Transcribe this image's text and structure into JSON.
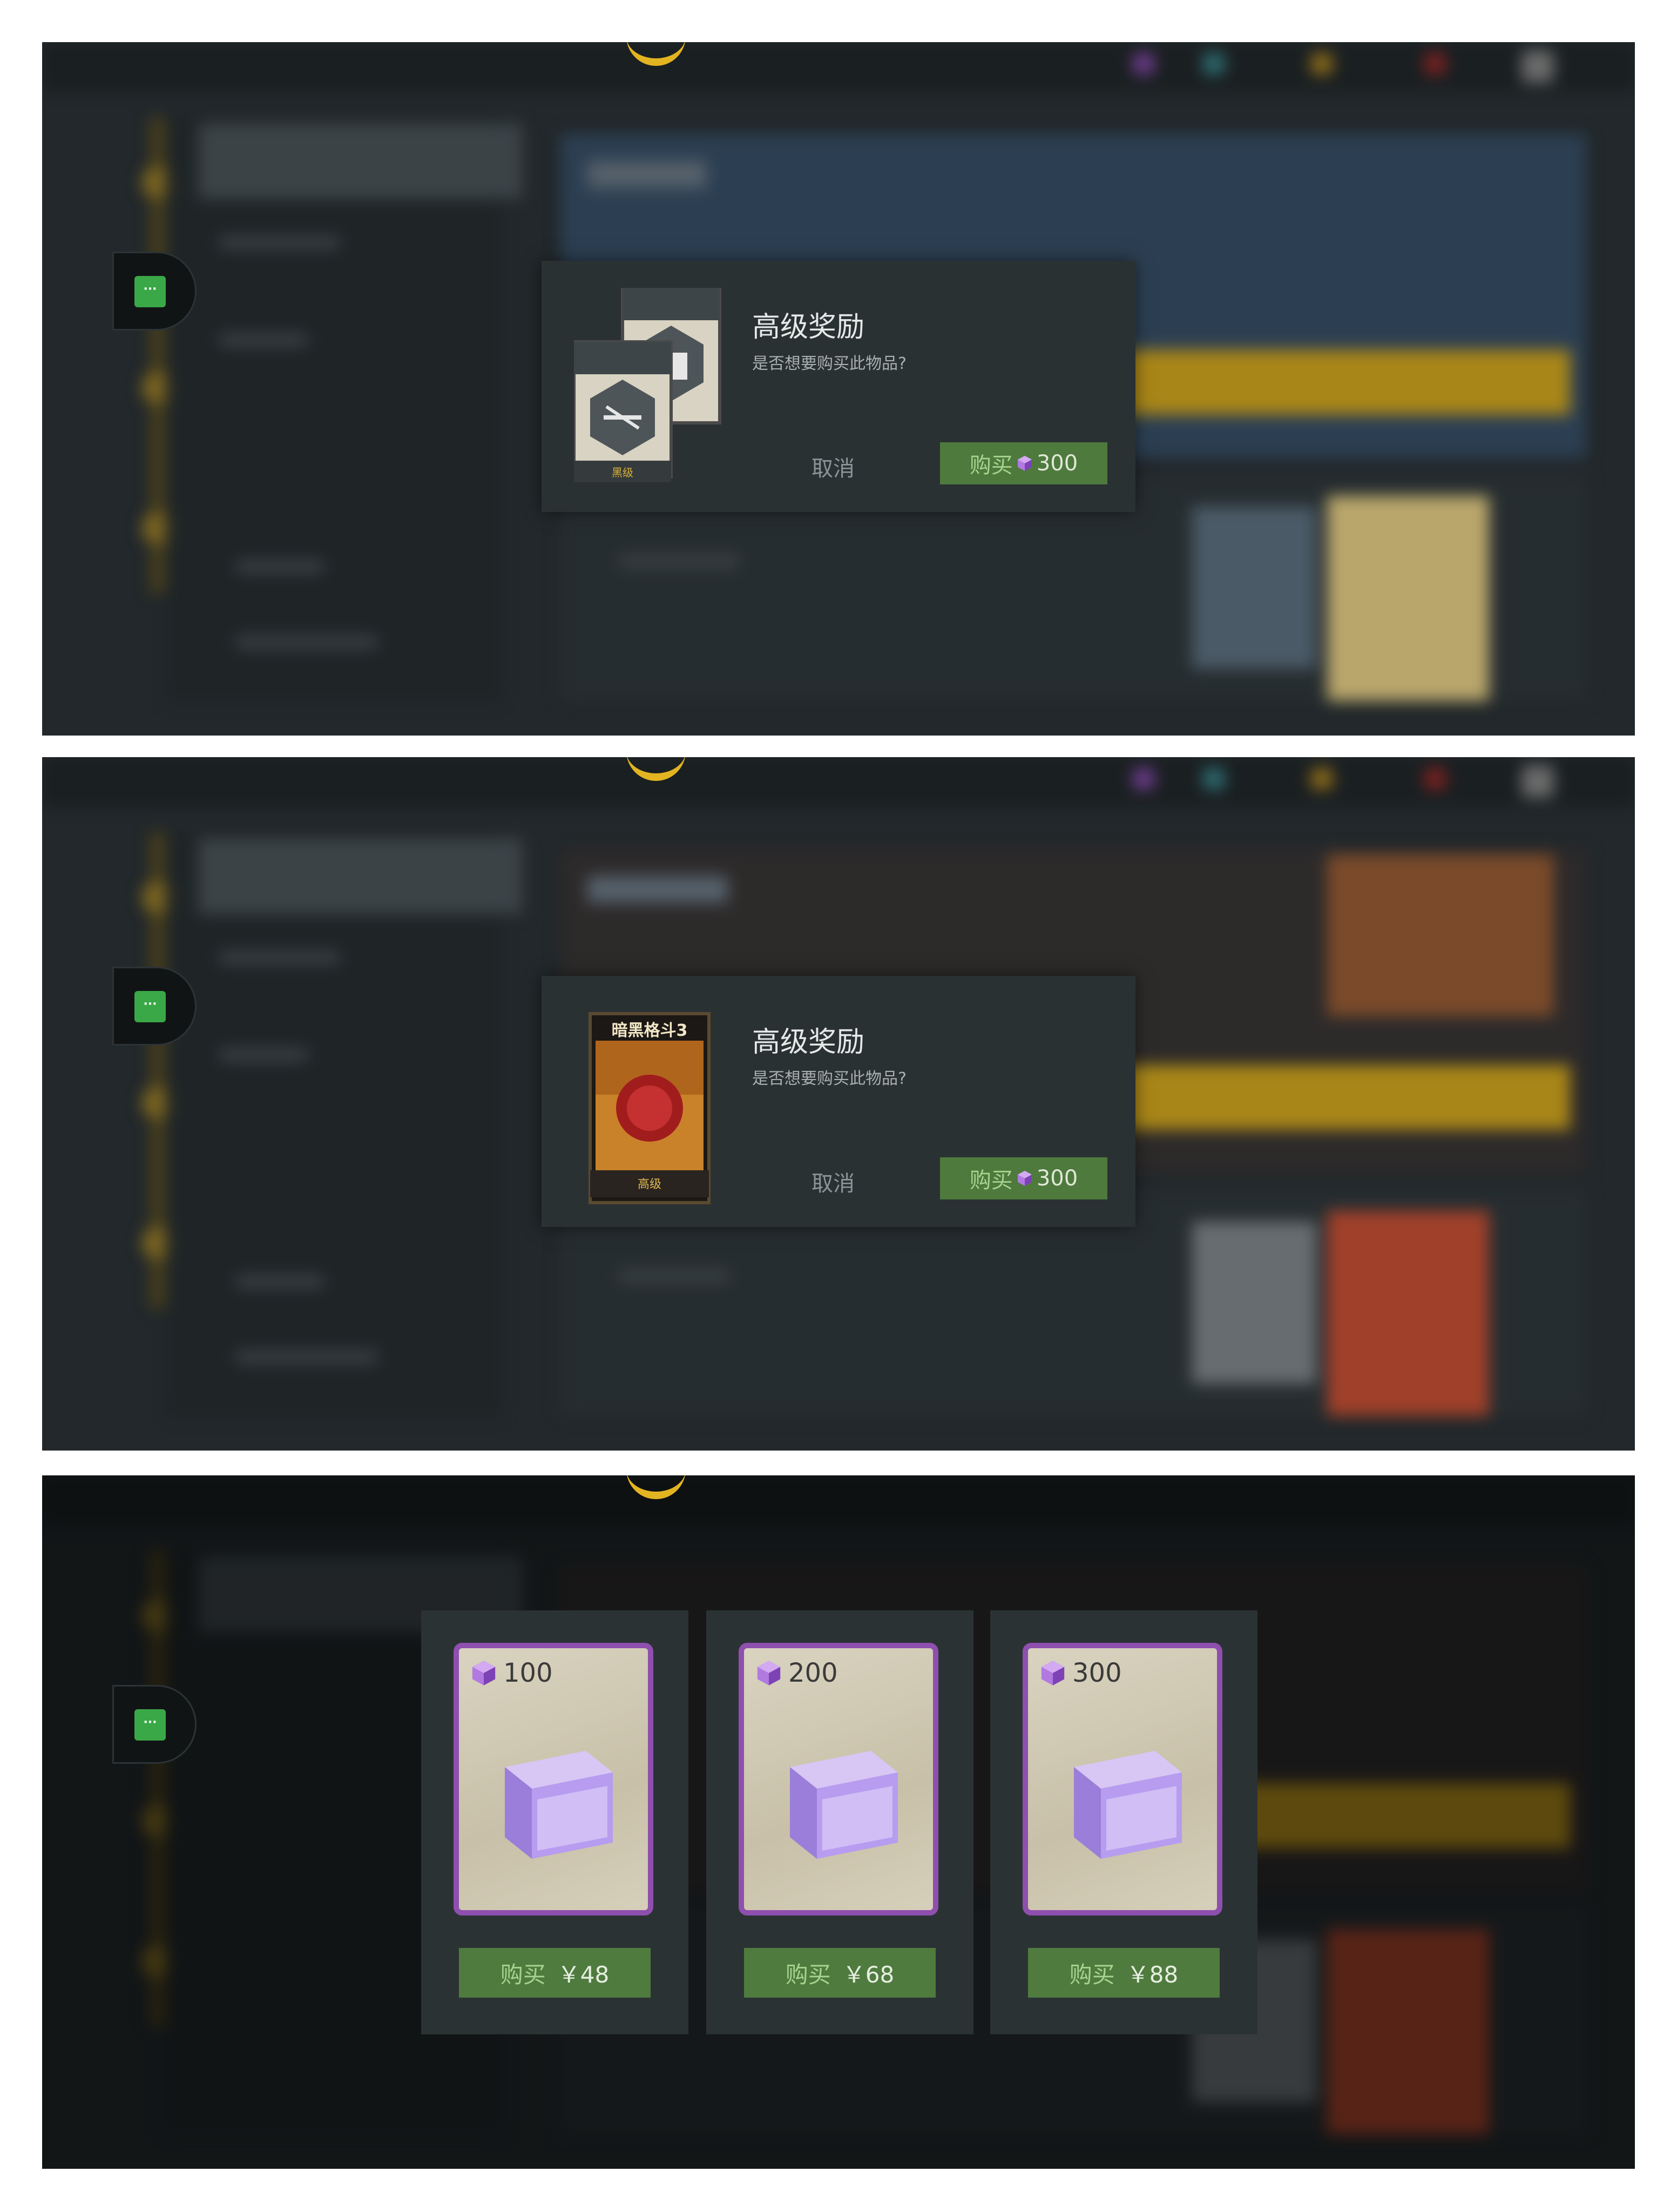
{
  "chat_button_label": "···",
  "dialogs": [
    {
      "title": "高级奖励",
      "question": "是否想要购买此物品?",
      "cancel": "取消",
      "buy_label": "购买",
      "price": "300",
      "item_caption": "黑级"
    },
    {
      "title": "高级奖励",
      "question": "是否想要购买此物品?",
      "cancel": "取消",
      "buy_label": "购买",
      "price": "300",
      "item_caption": "高级",
      "item_game_title": "暗黑格斗3"
    }
  ],
  "shop": {
    "items": [
      {
        "amount": "100",
        "buy_label": "购买",
        "price": "￥48"
      },
      {
        "amount": "200",
        "buy_label": "购买",
        "price": "￥68"
      },
      {
        "amount": "300",
        "buy_label": "购买",
        "price": "￥88"
      }
    ]
  },
  "colors": {
    "accent_green": "#4e7a3d",
    "premium_gold": "#e3b421",
    "gem_purple": "#9b5fd0"
  },
  "icons": [
    "moustache-icon",
    "chat-icon",
    "gem-icon",
    "crystal-cube-icon"
  ]
}
